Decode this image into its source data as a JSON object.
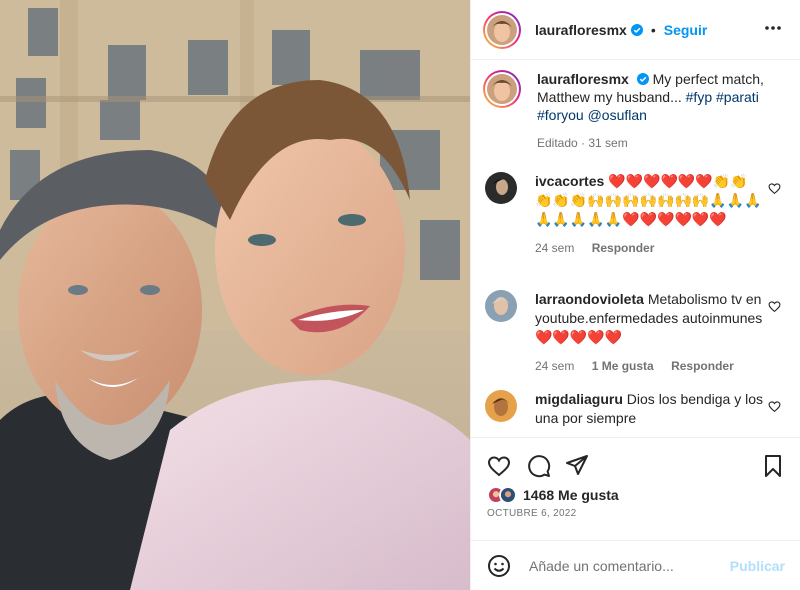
{
  "photo": {
    "alt_icons": [
      "building-icon",
      "person-icon"
    ]
  },
  "post": {
    "username": "laurafloresmx",
    "follow_label": "Seguir",
    "separator": "•",
    "caption_text": "My perfect match, Matthew my husband...",
    "hashtags": [
      "#fyp",
      "#parati",
      "#foryou"
    ],
    "mention": "@osuflan",
    "edited_meta": "Editado · 31 sem"
  },
  "comments": [
    {
      "username": "ivcacortes",
      "text": "❤️❤️❤️❤️❤️❤️👏👏👏👏👏🙌🙌🙌🙌🙌🙌🙌🙏🙏🙏🙏🙏🙏🙏🙏❤️❤️❤️❤️❤️❤️",
      "time": "24 sem",
      "reply": "Responder"
    },
    {
      "username": "larraondovioleta",
      "text": "Metabolismo tv en youtube.enfermedades autoinmunes ❤️❤️❤️❤️❤️",
      "time": "24 sem",
      "likes": "1 Me gusta",
      "reply": "Responder"
    },
    {
      "username": "migdaliaguru",
      "text": "Dios los bendiga y los una por siempre"
    }
  ],
  "likes": {
    "count": "1468",
    "label": "Me gusta"
  },
  "date": "OCTUBRE 6, 2022",
  "add_comment": {
    "placeholder": "Añade un comentario...",
    "publish": "Publicar"
  },
  "colors": {
    "accent": "#0095f6",
    "link": "#00376b",
    "muted": "#737373",
    "publish_disabled": "#b2dffc"
  }
}
